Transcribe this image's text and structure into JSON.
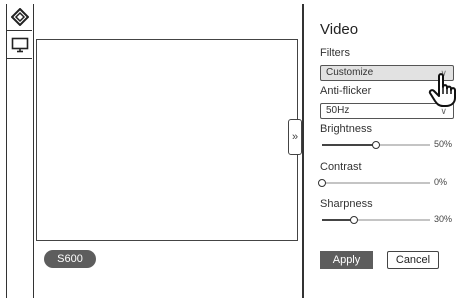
{
  "preview": {
    "device_label": "S600"
  },
  "panel": {
    "title": "Video",
    "filters": {
      "label": "Filters",
      "value": "Customize"
    },
    "antiflicker": {
      "label": "Anti-flicker",
      "value": "50Hz"
    },
    "brightness": {
      "label": "Brightness",
      "percent": 50,
      "value_text": "50%"
    },
    "contrast": {
      "label": "Contrast",
      "percent": 0,
      "value_text": "0%"
    },
    "sharpness": {
      "label": "Sharpness",
      "percent": 30,
      "value_text": "30%"
    },
    "apply_label": "Apply",
    "cancel_label": "Cancel"
  },
  "icons": {
    "toolbar": [
      "diamond-icon",
      "monitor-icon"
    ],
    "collapse": "double-chevron-right-icon",
    "cursor": "hand-pointer-icon"
  }
}
